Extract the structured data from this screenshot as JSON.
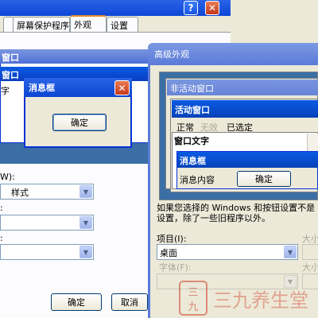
{
  "back_dialog": {
    "titlebar": {
      "help_symbol": "?",
      "close_symbol": "✕"
    },
    "tabs": [
      {
        "label": "屏幕保护程序"
      },
      {
        "label": "外观",
        "active": true
      },
      {
        "label": "设置"
      }
    ],
    "preview": {
      "inactive_title": "窗口",
      "active_title": "窗口",
      "window_text": "字"
    },
    "message_box": {
      "title": "消息框",
      "close_symbol": "✕",
      "ok_label": "确定"
    },
    "form": {
      "label1": "W):",
      "combo1_value": "样式",
      "label2": ":",
      "label3": ":"
    },
    "buttons": {
      "ok_label": "确定",
      "cancel_label": "取消"
    }
  },
  "front_dialog": {
    "title": "高级外观",
    "preview": {
      "inactive_window_title": "非活动窗口",
      "active_window_title": "活动窗口",
      "menu_items": [
        "正常",
        "无效",
        "已选定"
      ],
      "window_text": "窗口文字",
      "message_box_title": "消息框",
      "message_content": "消息内容",
      "ok_label": "确定"
    },
    "note_line1": "如果您选择的 Windows 和按钮设置不是 W",
    "note_line2": "设置，除了一些旧程序以外。",
    "item_label": "项目(I):",
    "item_value": "桌面",
    "size_label": "大小",
    "font_label": "字体(F):",
    "size2_label": "大小"
  },
  "watermark": {
    "text": "三九养生堂"
  },
  "colors": {
    "xp_blue": "#0a46d2",
    "inactive_blue": "#7a96df",
    "desktop_blue": "#3a6ea5",
    "dialog_bg": "#ece9d8",
    "close_red": "#c4381d"
  }
}
